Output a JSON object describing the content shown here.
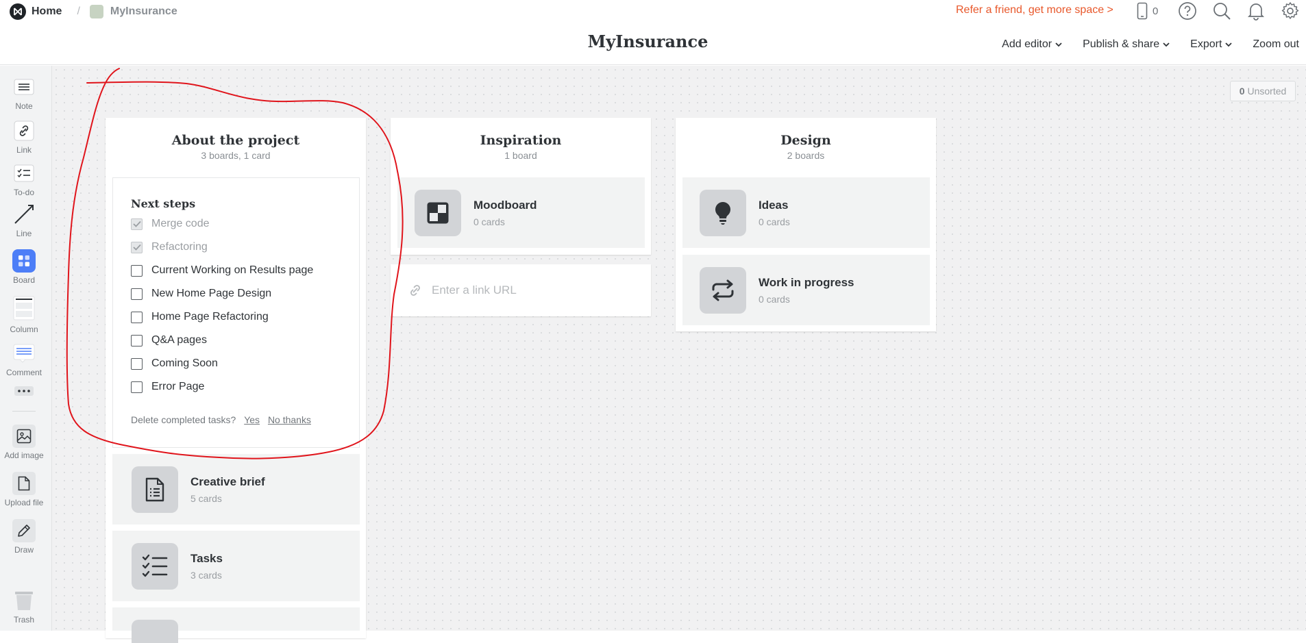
{
  "breadcrumb": {
    "home": "Home",
    "separator": "/",
    "board": "MyInsurance"
  },
  "topbar": {
    "refer": "Refer a friend, get more space >",
    "device_count": "0"
  },
  "page_title": "MyInsurance",
  "menu": {
    "add_editor": "Add editor",
    "publish_share": "Publish & share",
    "export": "Export",
    "zoom_out": "Zoom out"
  },
  "tools": {
    "note": "Note",
    "link": "Link",
    "todo": "To-do",
    "line": "Line",
    "board": "Board",
    "column": "Column",
    "comment": "Comment",
    "add_image": "Add image",
    "upload_file": "Upload file",
    "draw": "Draw",
    "trash": "Trash"
  },
  "unsorted": {
    "count": "0",
    "label": "Unsorted"
  },
  "columns": {
    "about": {
      "title": "About the project",
      "subtitle": "3 boards, 1 card",
      "todo": {
        "title": "Next steps",
        "tasks": [
          {
            "label": "Merge code",
            "done": true
          },
          {
            "label": "Refactoring",
            "done": true
          },
          {
            "label": "Current Working on Results page",
            "done": false
          },
          {
            "label": "New Home Page Design",
            "done": false
          },
          {
            "label": "Home Page Refactoring",
            "done": false
          },
          {
            "label": "Q&A pages",
            "done": false
          },
          {
            "label": "Coming Soon",
            "done": false
          },
          {
            "label": "Error Page",
            "done": false
          }
        ],
        "delete_prompt": "Delete completed tasks?",
        "yes": "Yes",
        "no": "No thanks"
      },
      "boards": [
        {
          "title": "Creative brief",
          "sub": "5 cards",
          "icon": "document-icon"
        },
        {
          "title": "Tasks",
          "sub": "3 cards",
          "icon": "checklist-icon"
        }
      ]
    },
    "inspiration": {
      "title": "Inspiration",
      "subtitle": "1 board",
      "boards": [
        {
          "title": "Moodboard",
          "sub": "0 cards",
          "icon": "moodboard-icon"
        }
      ],
      "link_placeholder": "Enter a link URL"
    },
    "design": {
      "title": "Design",
      "subtitle": "2 boards",
      "boards": [
        {
          "title": "Ideas",
          "sub": "0 cards",
          "icon": "lightbulb-icon"
        },
        {
          "title": "Work in progress",
          "sub": "0 cards",
          "icon": "repeat-icon"
        }
      ]
    }
  },
  "colors": {
    "accent": "#4d7ef7",
    "refer": "#e8572a",
    "annotation": "#e0141b"
  }
}
